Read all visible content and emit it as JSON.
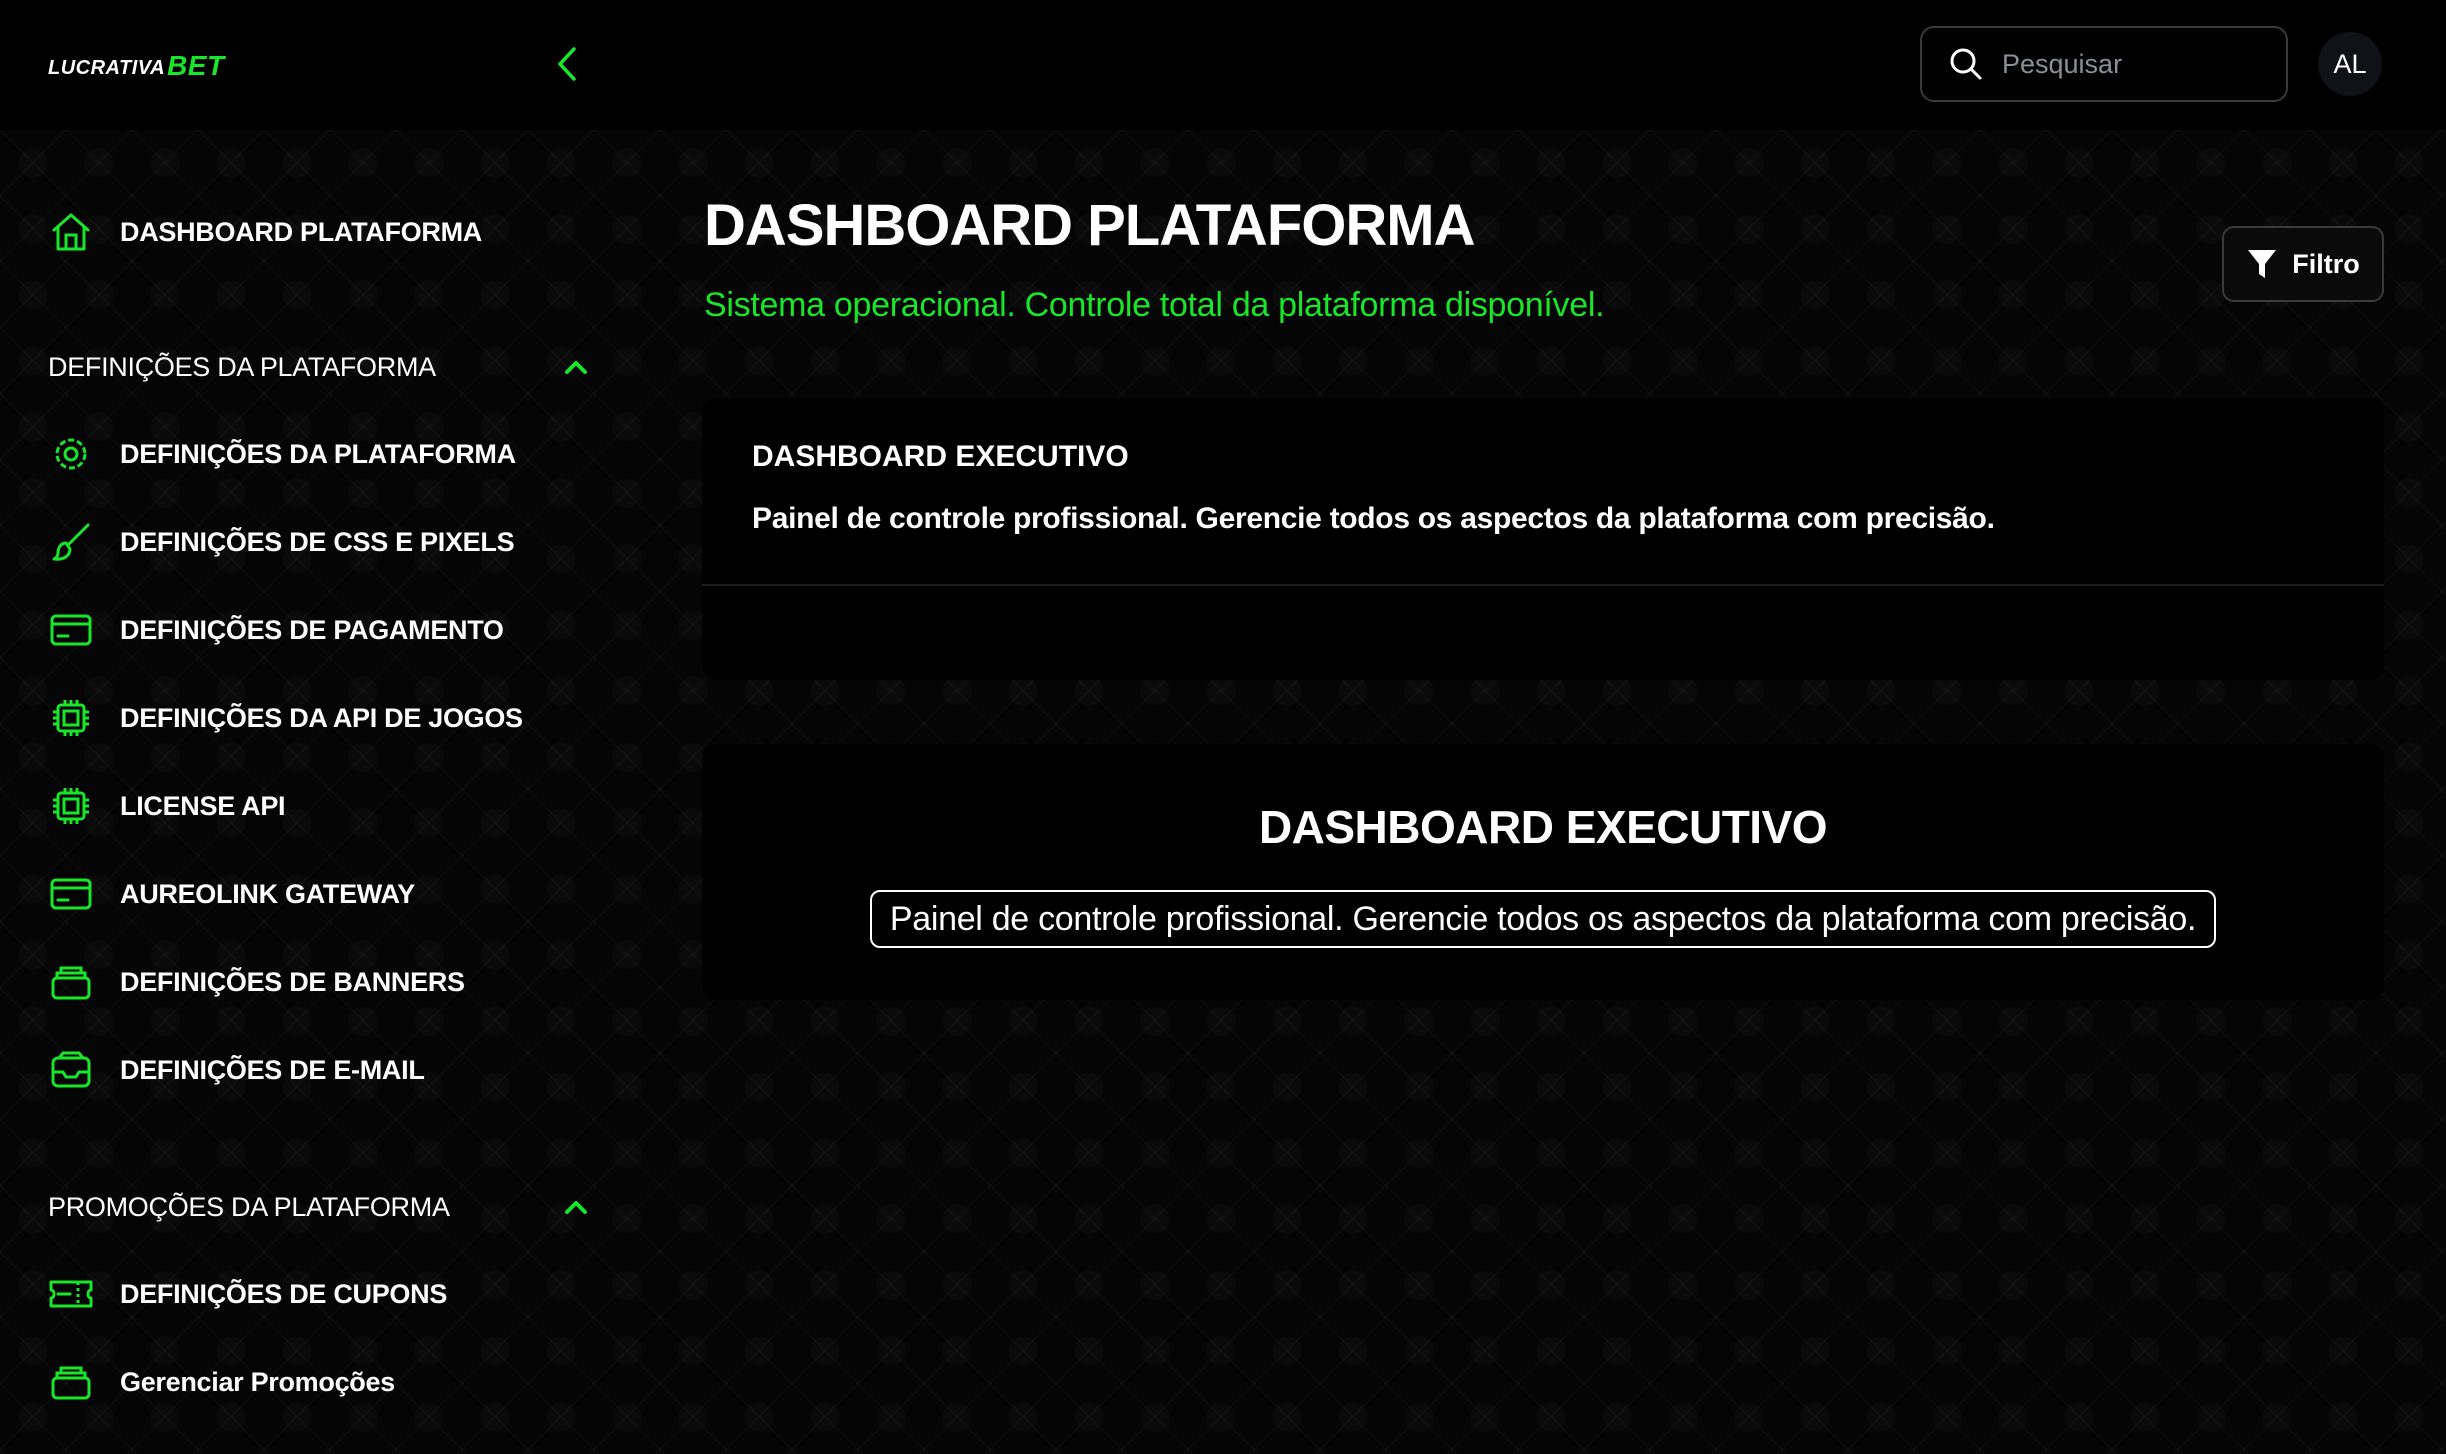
{
  "header": {
    "logo_text": "LUCRATIVA",
    "logo_accent": "BET",
    "search_placeholder": "Pesquisar",
    "avatar_initials": "AL"
  },
  "sidebar": {
    "dashboard_item": {
      "label": "DASHBOARD PLATAFORMA",
      "icon": "home-icon"
    },
    "sections": [
      {
        "title": "DEFINIÇÕES DA PLATAFORMA",
        "items": [
          {
            "label": "DEFINIÇÕES DA PLATAFORMA",
            "icon": "gear-icon"
          },
          {
            "label": "DEFINIÇÕES DE CSS E PIXELS",
            "icon": "brush-icon"
          },
          {
            "label": "DEFINIÇÕES DE PAGAMENTO",
            "icon": "credit-card-icon"
          },
          {
            "label": "DEFINIÇÕES DA API DE JOGOS",
            "icon": "chip-icon"
          },
          {
            "label": "LICENSE API",
            "icon": "chip-icon"
          },
          {
            "label": "AUREOLINK GATEWAY",
            "icon": "credit-card-icon"
          },
          {
            "label": "DEFINIÇÕES DE BANNERS",
            "icon": "layers-icon"
          },
          {
            "label": "DEFINIÇÕES DE E-MAIL",
            "icon": "inbox-icon"
          }
        ]
      },
      {
        "title": "PROMOÇÕES DA PLATAFORMA",
        "items": [
          {
            "label": "DEFINIÇÕES DE CUPONS",
            "icon": "ticket-icon"
          },
          {
            "label": "Gerenciar Promoções",
            "icon": "layers-icon"
          }
        ]
      }
    ]
  },
  "main": {
    "title": "DASHBOARD PLATAFORMA",
    "subtitle": "Sistema operacional. Controle total da plataforma disponível.",
    "filter_label": "Filtro",
    "card1": {
      "title": "DASHBOARD EXECUTIVO",
      "description": "Painel de controle profissional. Gerencie todos os aspectos da plataforma com precisão."
    },
    "card2": {
      "title": "DASHBOARD EXECUTIVO",
      "description": "Painel de controle profissional. Gerencie todos os aspectos da plataforma com precisão."
    }
  },
  "colors": {
    "accent": "#19e62b",
    "background": "#000000",
    "border": "#3a3a3a"
  }
}
